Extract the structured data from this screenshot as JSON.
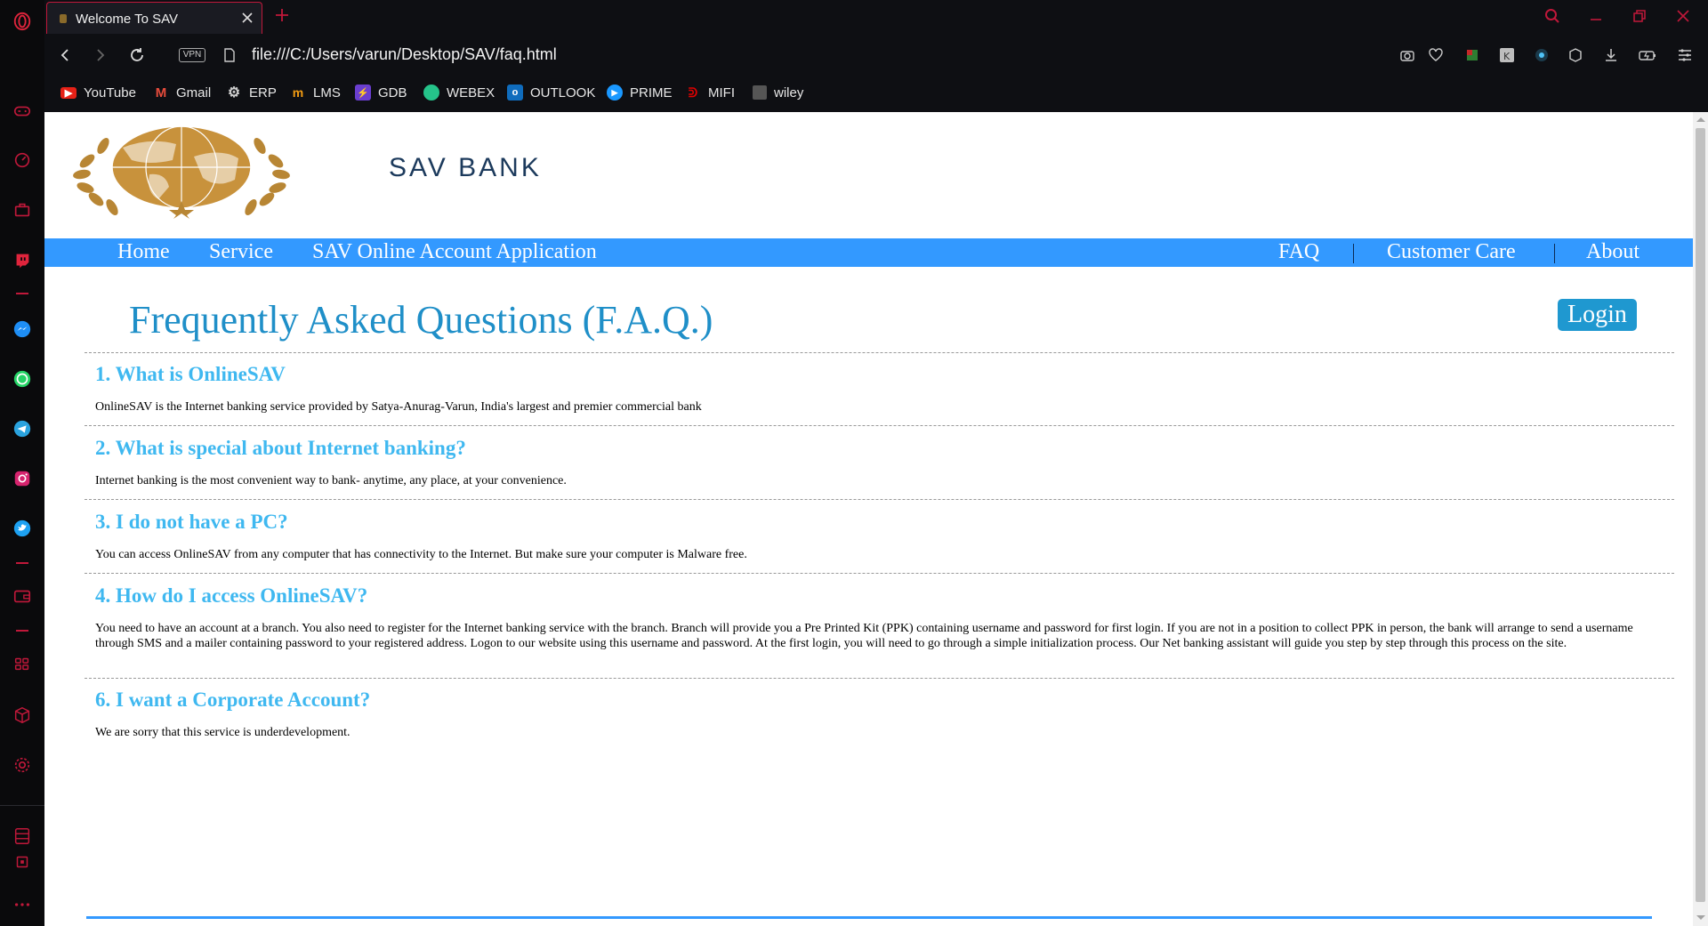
{
  "browser": {
    "tab_title": "Welcome To SAV",
    "url": "file:///C:/Users/varun/Desktop/SAV/faq.html",
    "vpn_label": "VPN",
    "bookmarks": [
      {
        "label": "YouTube",
        "icon": "youtube-icon"
      },
      {
        "label": "Gmail",
        "icon": "gmail-icon"
      },
      {
        "label": "ERP",
        "icon": "gear-icon"
      },
      {
        "label": "LMS",
        "icon": "lms-icon"
      },
      {
        "label": "GDB",
        "icon": "gdb-icon"
      },
      {
        "label": "WEBEX",
        "icon": "webex-icon"
      },
      {
        "label": "OUTLOOK",
        "icon": "outlook-icon"
      },
      {
        "label": "PRIME",
        "icon": "prime-icon"
      },
      {
        "label": "MIFI",
        "icon": "airtel-icon"
      },
      {
        "label": "wiley",
        "icon": "wiley-icon"
      }
    ],
    "accent_color": "#c0183a"
  },
  "site": {
    "brand": "SAV BANK",
    "nav_left": [
      "Home",
      "Service",
      "SAV Online Account Application"
    ],
    "nav_right": [
      "FAQ",
      "Customer Care",
      "About"
    ],
    "nav_color": "#3399ff",
    "login_label": "Login",
    "page_title": "Frequently Asked Questions (F.A.Q.)",
    "faqs": [
      {
        "question": "1. What is OnlineSAV",
        "answer": "OnlineSAV is the Internet banking service provided by Satya-Anurag-Varun, India's largest and premier commercial bank"
      },
      {
        "question": "2. What is special about Internet banking?",
        "answer": "Internet banking is the most convenient way to bank- anytime, any place, at your convenience."
      },
      {
        "question": "3. I do not have a PC?",
        "answer": "You can access OnlineSAV from any computer that has connectivity to the Internet. But make sure your computer is Malware free."
      },
      {
        "question": "4. How do I access OnlineSAV?",
        "answer": "You need to have an account at a branch. You also need to register for the Internet banking service with the branch. Branch will provide you a Pre Printed Kit (PPK) containing username and password for first login. If you are not in a position to collect PPK in person, the bank will arrange to send a username through SMS and a mailer containing password to your registered address. Logon to our website using this username and password. At the first login, you will need to go through a simple initialization process. Our Net banking assistant will guide you step by step through this process on the site."
      },
      {
        "question": "6. I want a Corporate Account?",
        "answer": "We are sorry that this service is underdevelopment."
      }
    ]
  }
}
